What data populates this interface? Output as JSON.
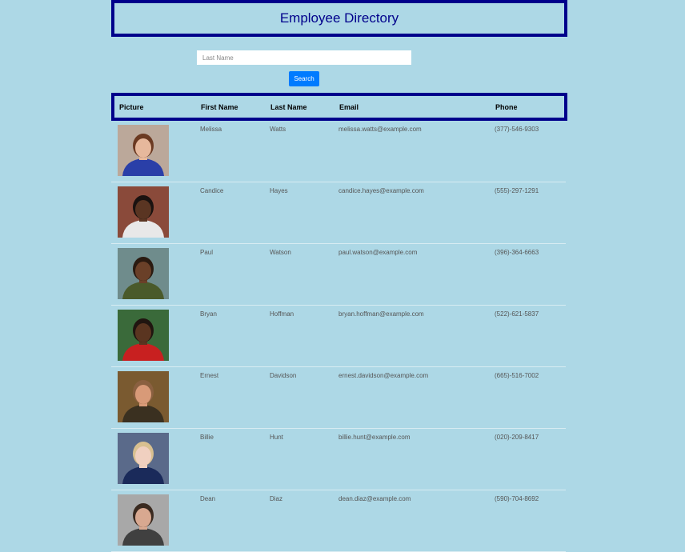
{
  "header": {
    "title": "Employee Directory"
  },
  "search": {
    "placeholder": "Last Name",
    "value": "",
    "button_label": "Search"
  },
  "table": {
    "columns": [
      "Picture",
      "First Name",
      "Last Name",
      "Email",
      "Phone"
    ],
    "rows": [
      {
        "first": "Melissa",
        "last": "Watts",
        "email": "melissa.watts@example.com",
        "phone": "(377)-546-9303",
        "skin": "#e6b89c",
        "hair": "#6b3a22",
        "shirt": "#2a3fa8",
        "bg": "#bba89a"
      },
      {
        "first": "Candice",
        "last": "Hayes",
        "email": "candice.hayes@example.com",
        "phone": "(555)-297-1291",
        "skin": "#5a3522",
        "hair": "#1a1210",
        "shirt": "#e8e8e8",
        "bg": "#8a4a3a"
      },
      {
        "first": "Paul",
        "last": "Watson",
        "email": "paul.watson@example.com",
        "phone": "(396)-364-6663",
        "skin": "#6a4028",
        "hair": "#2a1a10",
        "shirt": "#4a5a2a",
        "bg": "#6f8c8c"
      },
      {
        "first": "Bryan",
        "last": "Hoffman",
        "email": "bryan.hoffman@example.com",
        "phone": "(522)-621-5837",
        "skin": "#5a3520",
        "hair": "#201510",
        "shirt": "#c82020",
        "bg": "#3a6a3a"
      },
      {
        "first": "Ernest",
        "last": "Davidson",
        "email": "ernest.davidson@example.com",
        "phone": "(665)-516-7002",
        "skin": "#d89a78",
        "hair": "#8a6040",
        "shirt": "#3a3020",
        "bg": "#7a5a30"
      },
      {
        "first": "Billie",
        "last": "Hunt",
        "email": "billie.hunt@example.com",
        "phone": "(020)-209-8417",
        "skin": "#f0d0c0",
        "hair": "#d8c090",
        "shirt": "#1a2a5a",
        "bg": "#5a6a8a"
      },
      {
        "first": "Dean",
        "last": "Diaz",
        "email": "dean.diaz@example.com",
        "phone": "(590)-704-8692",
        "skin": "#d8a890",
        "hair": "#3a2a20",
        "shirt": "#404040",
        "bg": "#a8a8a8"
      }
    ]
  }
}
